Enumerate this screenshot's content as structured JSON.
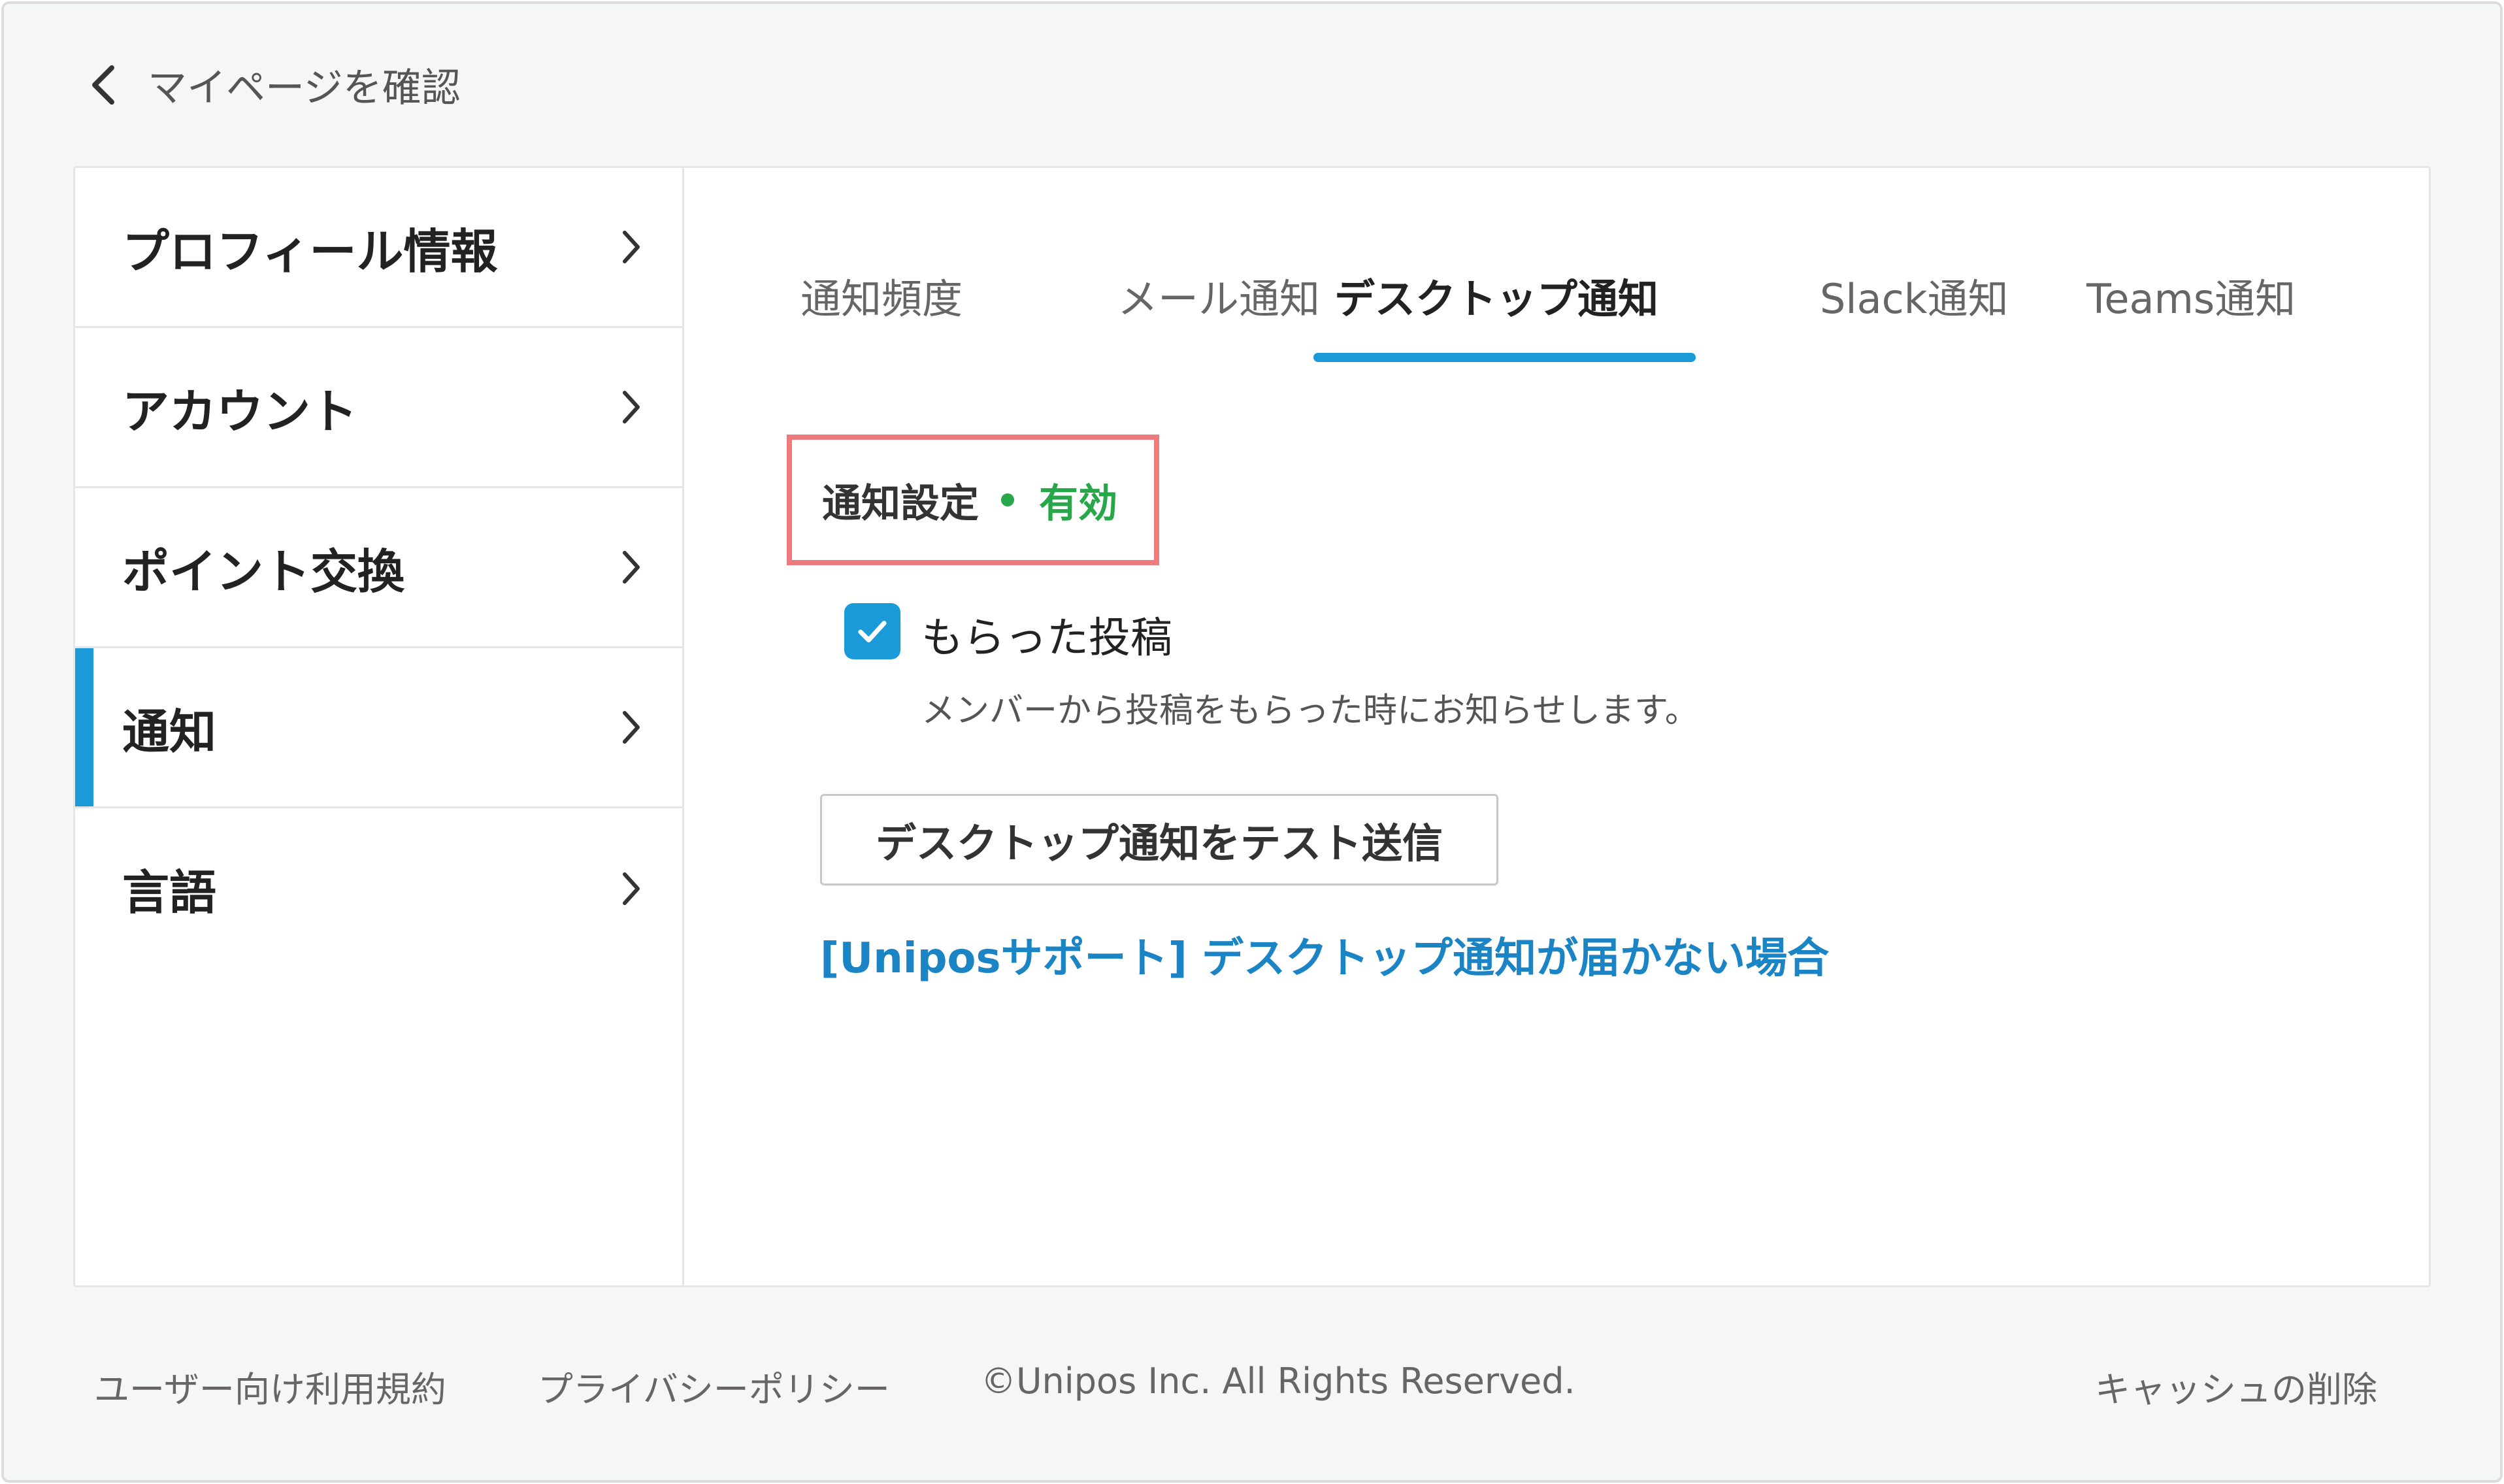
{
  "header": {
    "back_label": "マイページを確認"
  },
  "sidebar": {
    "items": [
      {
        "label": "プロフィール情報"
      },
      {
        "label": "アカウント"
      },
      {
        "label": "ポイント交換"
      },
      {
        "label": "通知",
        "active": true
      },
      {
        "label": "言語"
      }
    ]
  },
  "tabs": [
    {
      "label": "通知頻度"
    },
    {
      "label": "メール通知"
    },
    {
      "label": "デスクトップ通知",
      "active": true
    },
    {
      "label": "Slack通知"
    },
    {
      "label": "Teams通知"
    }
  ],
  "notification_setting": {
    "label": "通知設定",
    "status": "有効",
    "status_color": "#27a74a"
  },
  "received_posts": {
    "checked": true,
    "label": "もらった投稿",
    "description": "メンバーから投稿をもらった時にお知らせします。"
  },
  "test_button_label": "デスクトップ通知をテスト送信",
  "support_link_text": "[Uniposサポート] デスクトップ通知が届かない場合",
  "footer": {
    "terms": "ユーザー向け利用規約",
    "privacy": "プライバシーポリシー",
    "copyright": "©Unipos Inc. All Rights Reserved.",
    "clear_cache": "キャッシュの削除"
  },
  "colors": {
    "accent": "#1a9ad9",
    "link": "#1b84c4",
    "highlight_border": "#ee7a7e"
  }
}
